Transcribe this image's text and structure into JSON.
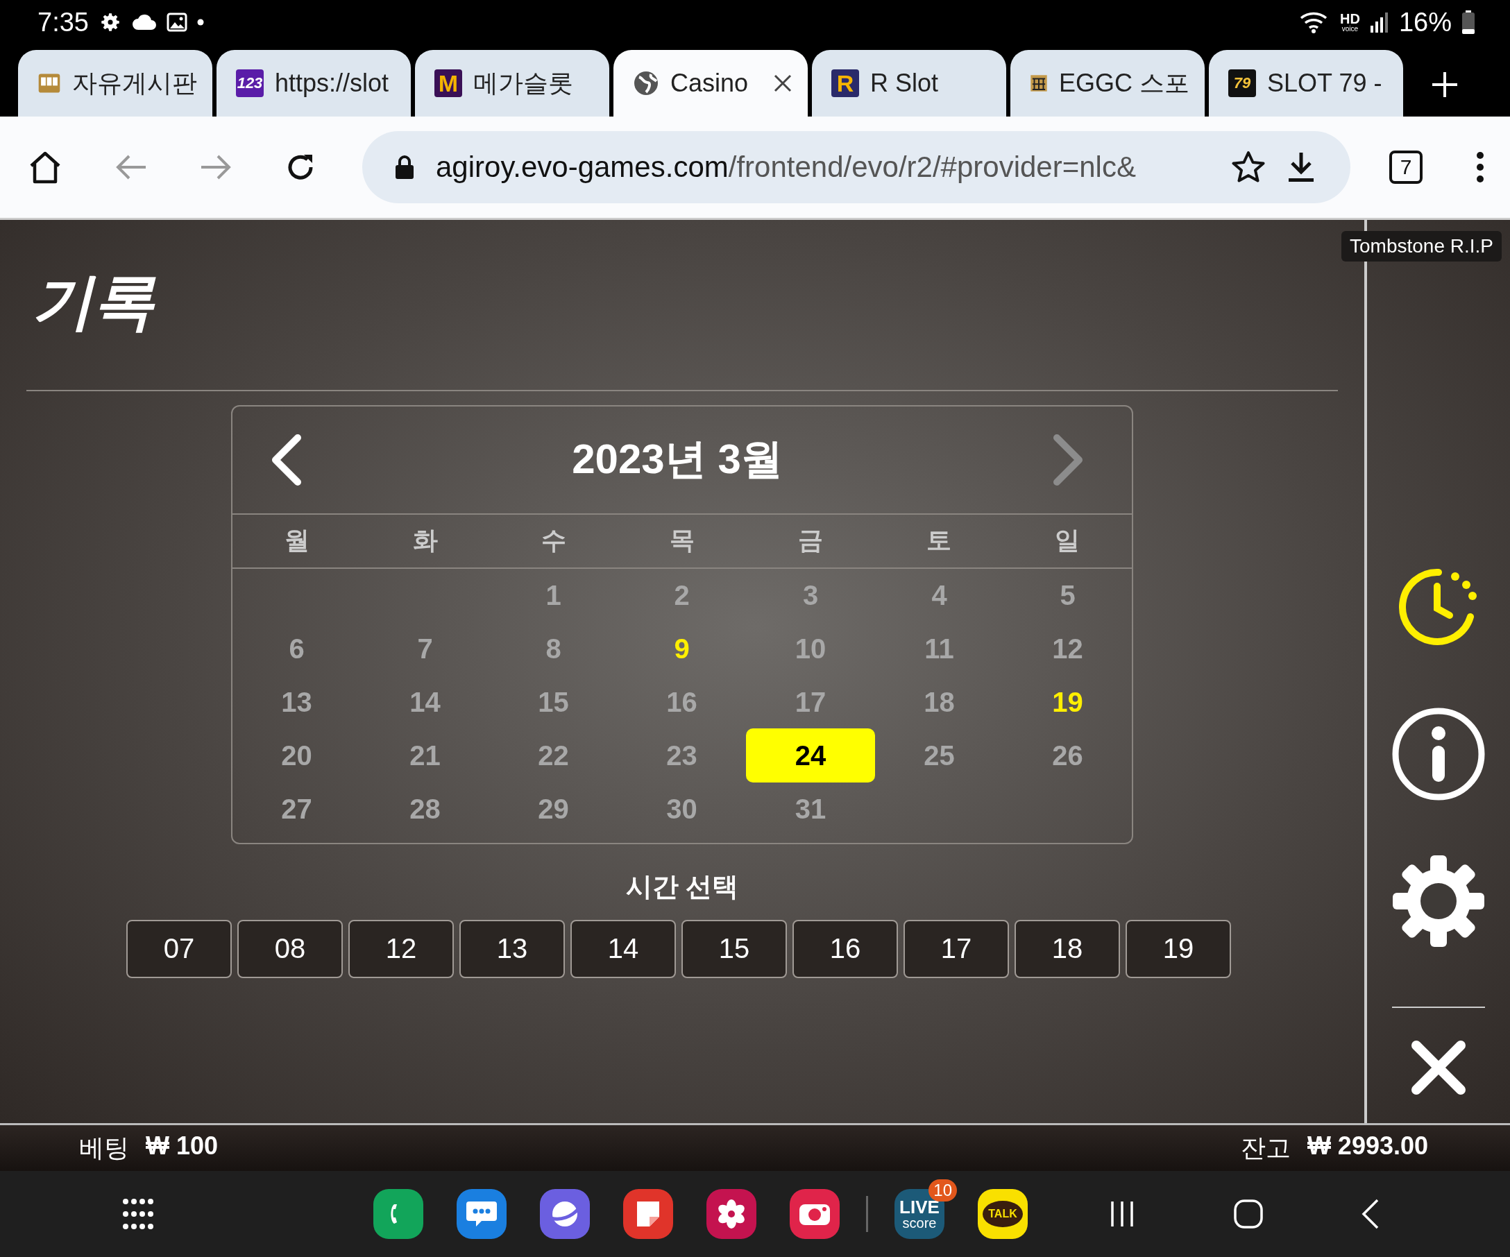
{
  "status_bar": {
    "time": "7:35",
    "hd": "HD",
    "voice": "voice",
    "battery": "16%"
  },
  "tabs": [
    {
      "title": "자유게시판",
      "kind": "slot",
      "selected": false
    },
    {
      "title": "https://slot",
      "kind": "num",
      "icon_text": "123",
      "selected": false
    },
    {
      "title": "메가슬롯",
      "kind": "m",
      "icon_text": "M",
      "selected": false
    },
    {
      "title": "Casino",
      "kind": "globe",
      "selected": true
    },
    {
      "title": "R Slot",
      "kind": "r",
      "icon_text": "R",
      "selected": false
    },
    {
      "title": "EGGC 스포",
      "kind": "eggc",
      "selected": false
    },
    {
      "title": "SLOT 79 -",
      "kind": "s79",
      "icon_text": "79",
      "selected": false
    }
  ],
  "address_bar": {
    "host": "agiroy.evo-games.com",
    "path": "/frontend/evo/r2/#provider=nlc&",
    "tab_count": "7"
  },
  "game_title": "Tombstone R.I.P",
  "heading": "기록",
  "calendar": {
    "title": "2023년 3월",
    "weekdays": [
      "월",
      "화",
      "수",
      "목",
      "금",
      "토",
      "일"
    ],
    "weeks": [
      [
        {
          "day": "1",
          "marked": false,
          "selected": false
        },
        {
          "day": "2",
          "marked": false,
          "selected": false
        },
        {
          "day": "3",
          "marked": false,
          "selected": false
        },
        {
          "day": "4",
          "marked": false,
          "selected": false
        },
        {
          "day": "5",
          "marked": false,
          "selected": false
        }
      ],
      [
        {
          "day": "6",
          "marked": false,
          "selected": false
        },
        {
          "day": "7",
          "marked": false,
          "selected": false
        },
        {
          "day": "8",
          "marked": false,
          "selected": false
        },
        {
          "day": "9",
          "marked": true,
          "selected": false
        },
        {
          "day": "10",
          "marked": false,
          "selected": false
        },
        {
          "day": "11",
          "marked": false,
          "selected": false
        },
        {
          "day": "12",
          "marked": false,
          "selected": false
        }
      ],
      [
        {
          "day": "13",
          "marked": false,
          "selected": false
        },
        {
          "day": "14",
          "marked": false,
          "selected": false
        },
        {
          "day": "15",
          "marked": false,
          "selected": false
        },
        {
          "day": "16",
          "marked": false,
          "selected": false
        },
        {
          "day": "17",
          "marked": false,
          "selected": false
        },
        {
          "day": "18",
          "marked": false,
          "selected": false
        },
        {
          "day": "19",
          "marked": true,
          "selected": false
        }
      ],
      [
        {
          "day": "20",
          "marked": false,
          "selected": false
        },
        {
          "day": "21",
          "marked": false,
          "selected": false
        },
        {
          "day": "22",
          "marked": false,
          "selected": false
        },
        {
          "day": "23",
          "marked": false,
          "selected": false
        },
        {
          "day": "24",
          "marked": false,
          "selected": true
        },
        {
          "day": "25",
          "marked": false,
          "selected": false
        },
        {
          "day": "26",
          "marked": false,
          "selected": false
        }
      ],
      [
        {
          "day": "27",
          "marked": false,
          "selected": false
        },
        {
          "day": "28",
          "marked": false,
          "selected": false
        },
        {
          "day": "29",
          "marked": false,
          "selected": false
        },
        {
          "day": "30",
          "marked": false,
          "selected": false
        },
        {
          "day": "31",
          "marked": false,
          "selected": false
        }
      ]
    ]
  },
  "time_select": {
    "label": "시간 선택",
    "hours": [
      "07",
      "08",
      "12",
      "13",
      "14",
      "15",
      "16",
      "17",
      "18",
      "19"
    ]
  },
  "footer": {
    "bet_label": "베팅",
    "bet_currency": "₩",
    "bet": "100",
    "balance_label": "잔고",
    "balance_currency": "₩",
    "balance": "2993.00"
  },
  "dock": {
    "apps": [
      {
        "kind": "phone",
        "color": "#12a55a"
      },
      {
        "kind": "messages",
        "color": "#1a7fe0"
      },
      {
        "kind": "browser",
        "color": "#6b5fe0"
      },
      {
        "kind": "notes",
        "color": "#e0342a"
      },
      {
        "kind": "gallery",
        "color": "#c4134f"
      },
      {
        "kind": "camera",
        "color": "#e0244a"
      }
    ],
    "recent": [
      {
        "kind": "live",
        "color": "#1c5a78",
        "top": "LIVE",
        "bottom": "score",
        "badge": "10"
      },
      {
        "kind": "talk",
        "color": "#f9e000",
        "top": "TALK"
      }
    ]
  }
}
